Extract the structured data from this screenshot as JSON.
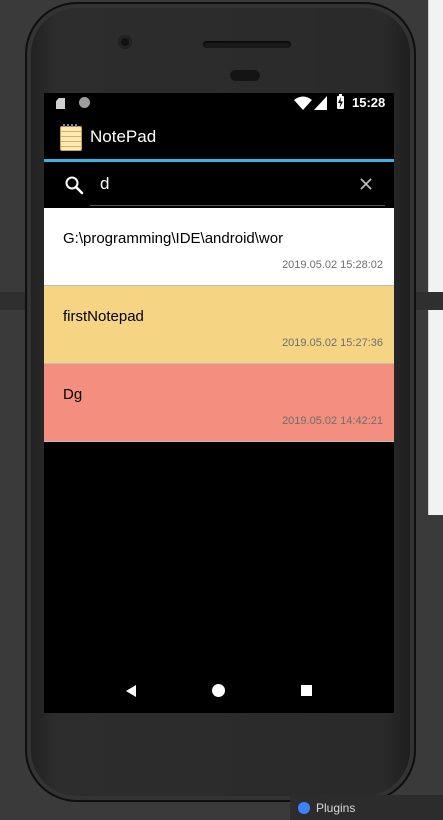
{
  "status_bar": {
    "time": "15:28",
    "icons": [
      "sd-card-icon",
      "circle-notification-icon",
      "wifi-icon",
      "signal-icon",
      "battery-charging-icon"
    ]
  },
  "app_bar": {
    "title": "NotePad",
    "icon": "notepad-icon",
    "accent_color": "#33b5e5"
  },
  "search": {
    "query": "d",
    "icons": {
      "search": "search-icon",
      "clear": "clear-icon"
    }
  },
  "notes": [
    {
      "title": "G:\\programming\\IDE\\android\\wor",
      "timestamp": "2019.05.02 15:28:02",
      "color": "#ffffff"
    },
    {
      "title": "firstNotepad",
      "timestamp": "2019.05.02 15:27:36",
      "color": "#f5d484"
    },
    {
      "title": "Dg",
      "timestamp": "2019.05.02 14:42:21",
      "color": "#f48f7f"
    }
  ],
  "nav_bar": {
    "icons": [
      "back-icon",
      "home-icon",
      "recents-icon"
    ]
  },
  "ide": {
    "footer_text": "Plugins"
  }
}
